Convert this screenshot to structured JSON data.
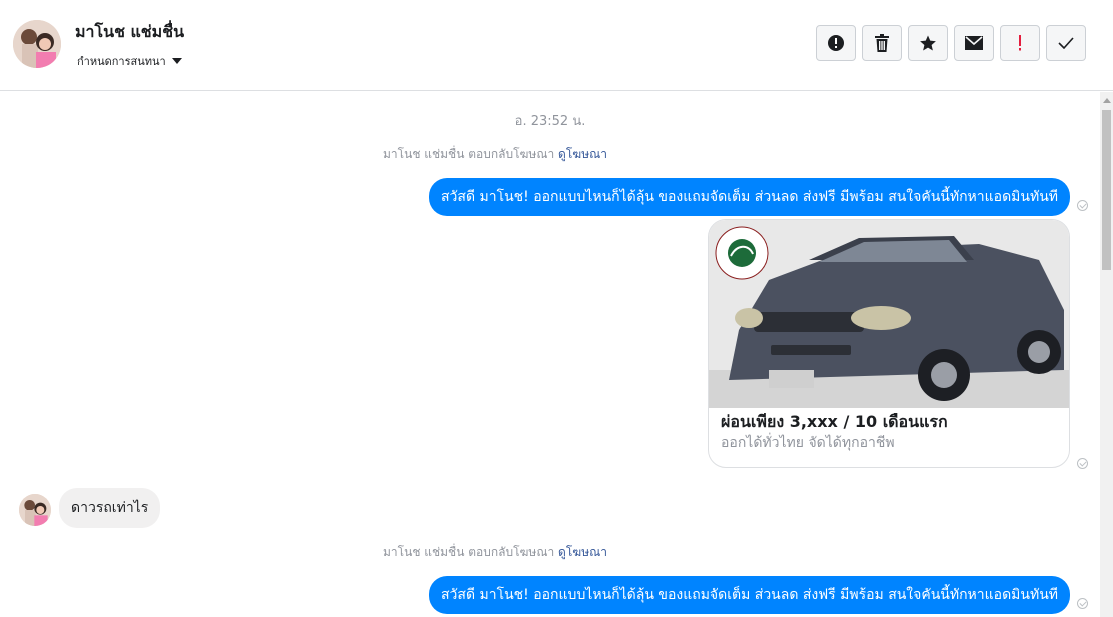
{
  "header": {
    "name": "มาโนช แช่มชื่น",
    "label_menu": "กำหนดการสนทนา"
  },
  "actions": [
    {
      "icon": "alert-circle-icon"
    },
    {
      "icon": "trash-icon"
    },
    {
      "icon": "star-icon"
    },
    {
      "icon": "envelope-icon"
    },
    {
      "icon": "exclamation-icon"
    },
    {
      "icon": "check-icon"
    }
  ],
  "thread": {
    "timestamp": "อ. 23:52 น.",
    "reply_prefix": "มาโนช แช่มชื่น ตอบกลับโฆษณา",
    "reply_link": "ดูโฆษณา",
    "outgoing_1": "สวัสดี มาโนช! ออกแบบไหนก็ได้ลุ้น ของแถมจัดเต็ม ส่วนลด ส่งฟรี มีพร้อม สนใจคันนี้ทักหาแอดมินทันที",
    "ad_card": {
      "title": "ผ่อนเพียง 3,xxx / 10 เดือนแรก",
      "subtitle": "ออกได้ทั่วไทย จัดได้ทุกอาชีพ"
    },
    "incoming_1": "ดาวรถเท่าไร",
    "reply_prefix_2": "มาโนช แช่มชื่น ตอบกลับโฆษณา",
    "reply_link_2": "ดูโฆษณา",
    "outgoing_2": "สวัสดี มาโนช! ออกแบบไหนก็ได้ลุ้น ของแถมจัดเต็ม ส่วนลด ส่งฟรี มีพร้อม สนใจคันนี้ทักหาแอดมินทันที"
  },
  "colors": {
    "accent": "#0084ff",
    "incoming_bubble": "#f1f0f0",
    "link": "#365899",
    "muted": "#90949c",
    "spam_red": "#e41e3f"
  }
}
